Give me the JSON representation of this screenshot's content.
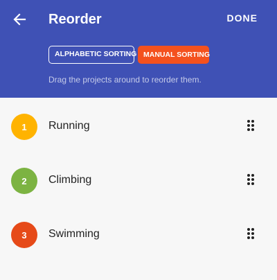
{
  "header": {
    "title": "Reorder",
    "done_label": "DONE",
    "back_icon": "arrow-left-icon",
    "background_color": "#3f51b5"
  },
  "sorting": {
    "alphabetic_label": "ALPHABETIC SORTING",
    "manual_label": "MANUAL SORTING",
    "selected": "manual",
    "manual_color": "#f4511e"
  },
  "hint": "Drag the projects around to reorder them.",
  "projects": [
    {
      "number": "1",
      "name": "Running",
      "color": "#ffb300"
    },
    {
      "number": "2",
      "name": "Climbing",
      "color": "#7cb342"
    },
    {
      "number": "3",
      "name": "Swimming",
      "color": "#e64a19"
    }
  ],
  "row_handle_icon": "drag-handle-icon"
}
